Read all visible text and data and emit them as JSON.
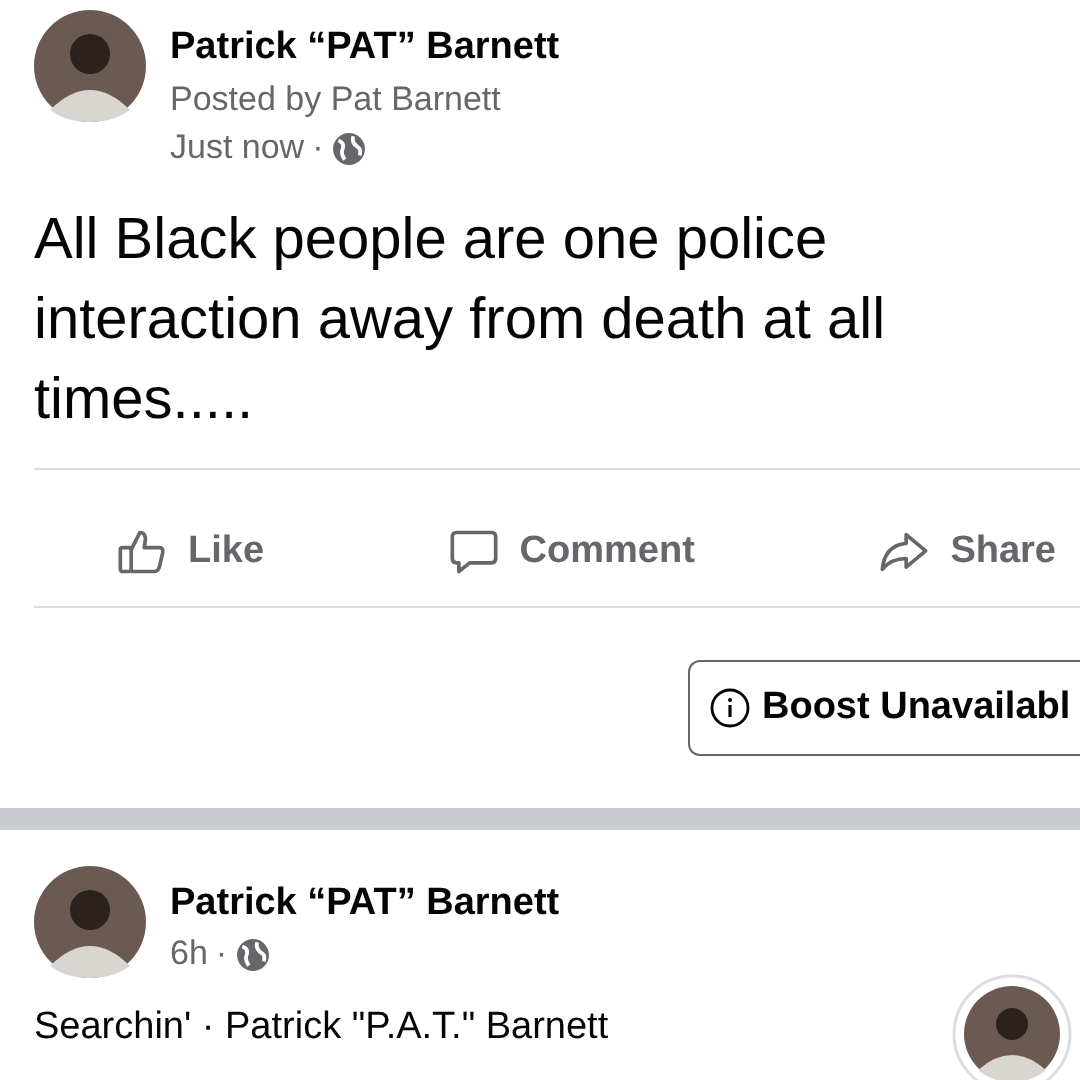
{
  "posts": [
    {
      "author": "Patrick “PAT” Barnett",
      "posted_by": "Posted by Pat Barnett",
      "time": "Just now",
      "separator": "·",
      "public": true,
      "text": "All Black people are one police interaction away from death at all times.....",
      "actions": [
        {
          "kind": "like",
          "label": "Like"
        },
        {
          "kind": "comment",
          "label": "Comment"
        },
        {
          "kind": "share",
          "label": "Share"
        }
      ],
      "boost": {
        "label": "Boost Unavailabl",
        "disabled": true
      }
    },
    {
      "author": "Patrick “PAT” Barnett",
      "time": "6h",
      "separator": "·",
      "public": true,
      "text": "Searchin' · Patrick \"P.A.T.\" Barnett"
    }
  ]
}
